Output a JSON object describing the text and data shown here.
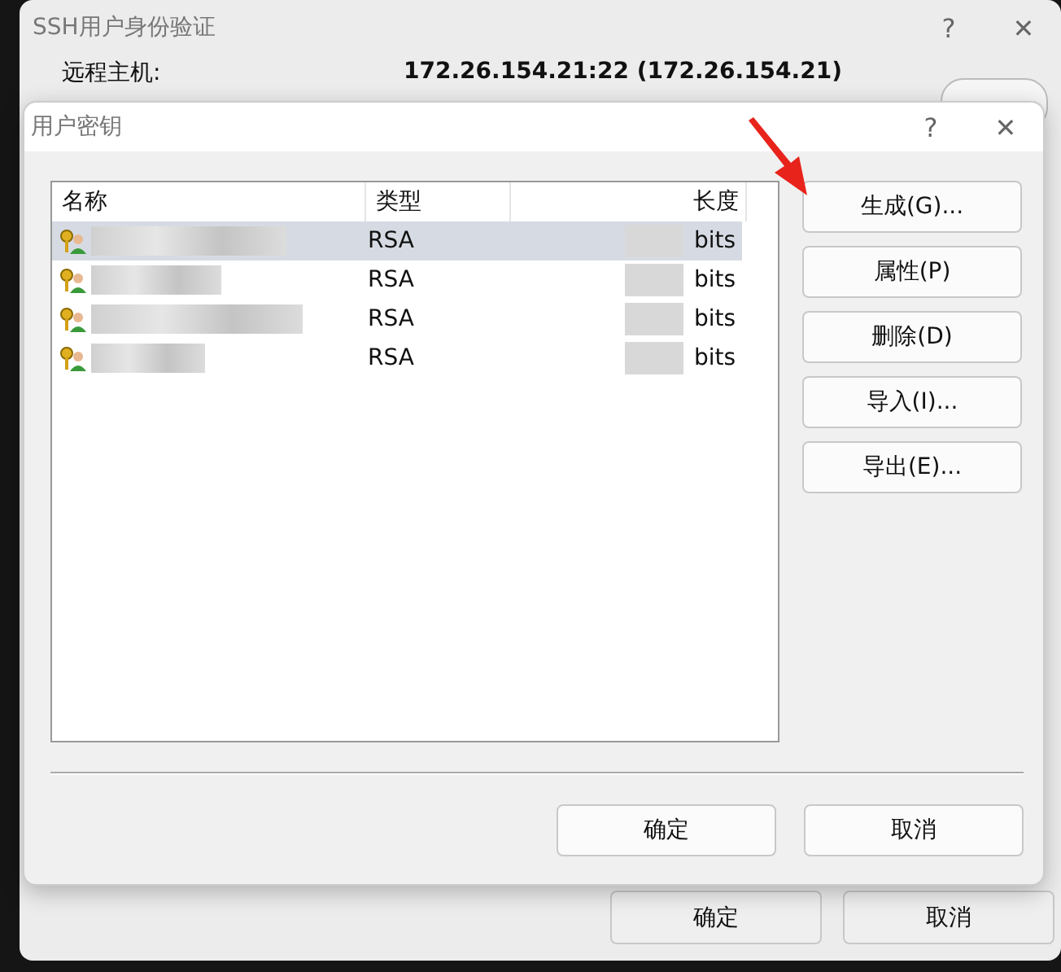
{
  "outer_window": {
    "title": "SSH用户身份验证",
    "help": "?",
    "close": "✕",
    "host_label": "远程主机:",
    "host_value": "172.26.154.21:22 (172.26.154.21)",
    "buttons": [
      "确定",
      "取消"
    ]
  },
  "dialog": {
    "title": "用户密钥",
    "help": "?",
    "close": "✕",
    "table": {
      "columns": [
        "名称",
        "类型",
        "长度"
      ],
      "rows": [
        {
          "type": "RSA",
          "length": "bits",
          "selected": true
        },
        {
          "type": "RSA",
          "length": "bits",
          "selected": false
        },
        {
          "type": "RSA",
          "length": "bits",
          "selected": false
        },
        {
          "type": "RSA",
          "length": "bits",
          "selected": false
        }
      ]
    },
    "side_buttons": [
      "生成(G)...",
      "属性(P)",
      "删除(D)",
      "导入(I)...",
      "导出(E)..."
    ],
    "buttons": [
      "确定",
      "取消"
    ]
  }
}
